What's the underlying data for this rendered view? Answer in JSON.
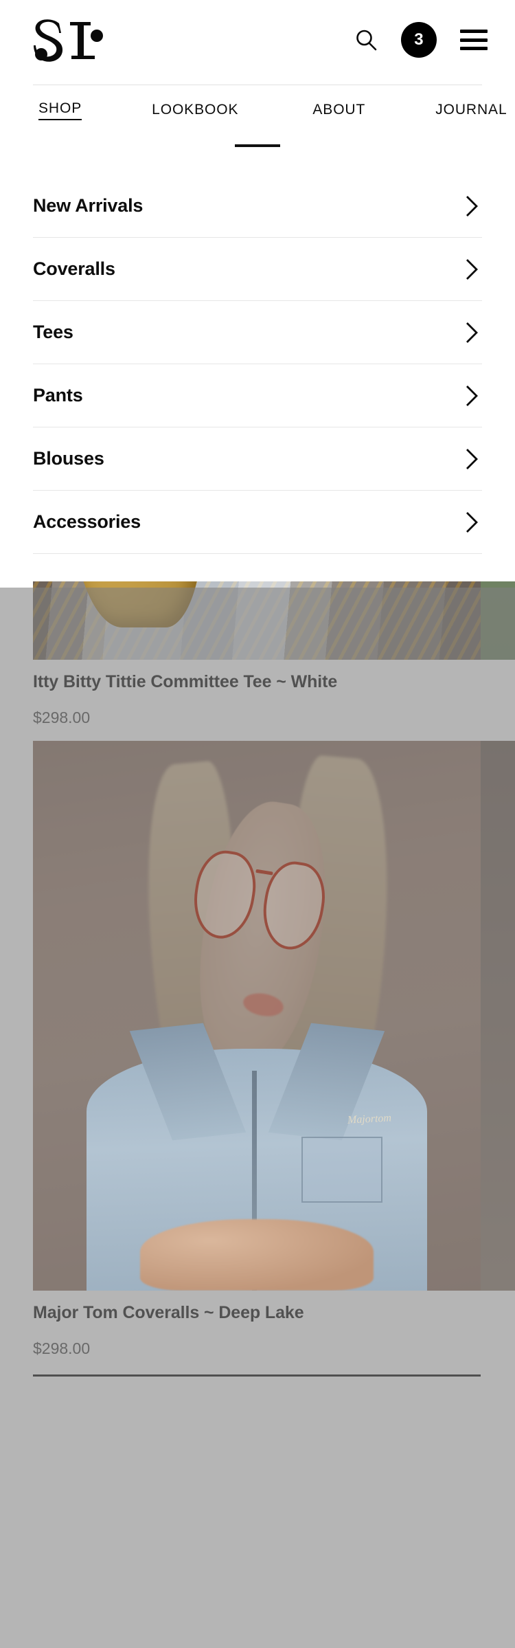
{
  "brand": {
    "logo_text": "SL",
    "logo_name": "sl-monogram-logo"
  },
  "header": {
    "search_icon": "search-icon",
    "cart_icon": "cart-badge-icon",
    "cart_count": "3",
    "menu_icon": "hamburger-menu-icon"
  },
  "tabs": [
    {
      "label": "SHOP",
      "active": true
    },
    {
      "label": "LOOKBOOK",
      "active": false
    },
    {
      "label": "ABOUT",
      "active": false
    },
    {
      "label": "JOURNAL",
      "active": false
    }
  ],
  "categories": [
    {
      "label": "New Arrivals",
      "chevron": "chevron-right-icon"
    },
    {
      "label": "Coveralls",
      "chevron": "chevron-right-icon"
    },
    {
      "label": "Tees",
      "chevron": "chevron-right-icon"
    },
    {
      "label": "Pants",
      "chevron": "chevron-right-icon"
    },
    {
      "label": "Blouses",
      "chevron": "chevron-right-icon"
    },
    {
      "label": "Accessories",
      "chevron": "chevron-right-icon"
    }
  ],
  "products": [
    {
      "title": "Itty Bitty Tittie Committee Tee ~ White",
      "price": "$298.00",
      "image_alt": "model-in-light-denim-holding-vintage-yellow-telephone"
    },
    {
      "title": "Major Tom Coveralls ~ Deep Lake",
      "price": "$298.00",
      "image_alt": "blonde-model-wearing-light-blue-coveralls-and-aviator-glasses",
      "embroidery": "Majortom"
    }
  ],
  "colors": {
    "accent": "#000000",
    "text": "#0d0d0d",
    "price_text": "#4a4a4a",
    "divider": "#e6e6e6",
    "product_rule": "#0c0c0c",
    "scrim": "#808080",
    "panel": "#ffffff"
  }
}
